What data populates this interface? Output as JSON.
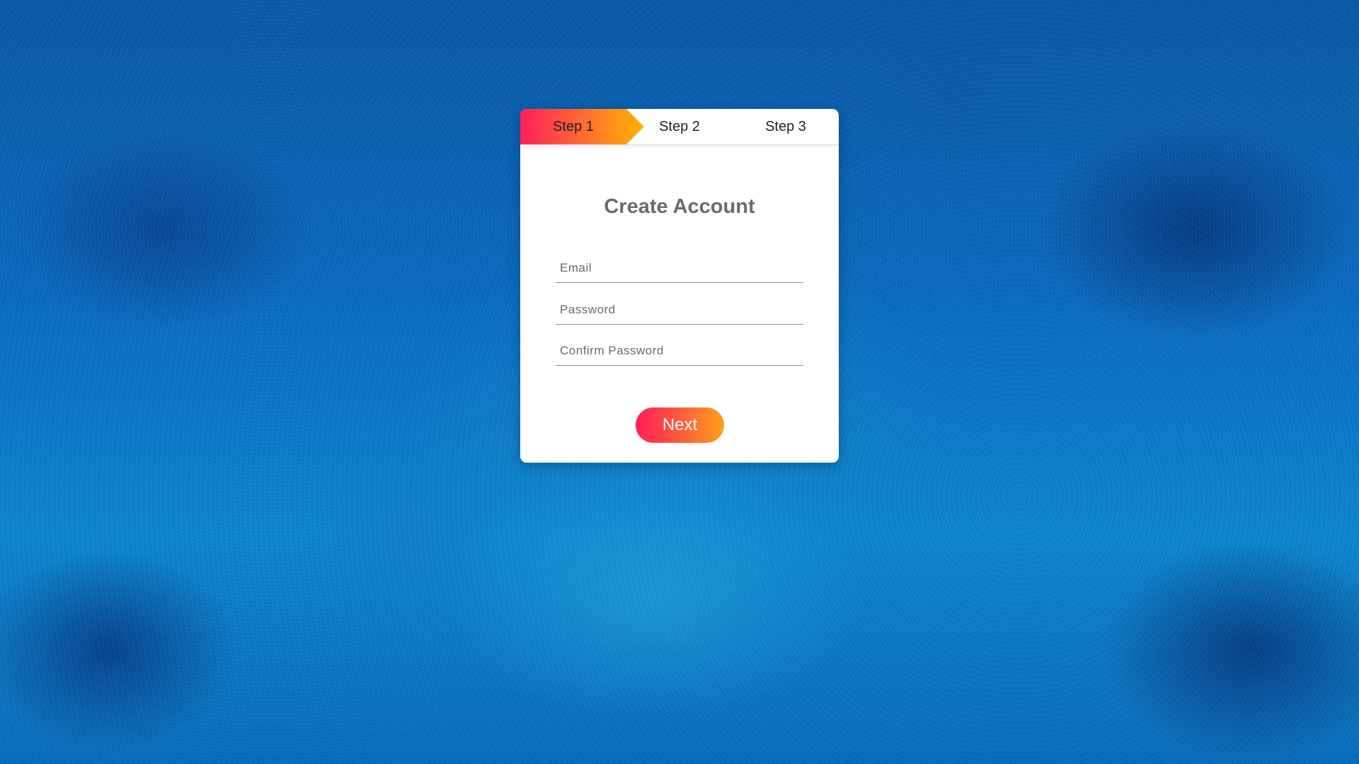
{
  "steps": [
    {
      "label": "Step 1",
      "active": true
    },
    {
      "label": "Step 2",
      "active": false
    },
    {
      "label": "Step 3",
      "active": false
    }
  ],
  "form": {
    "title": "Create Account",
    "email_placeholder": "Email",
    "password_placeholder": "Password",
    "confirm_password_placeholder": "Confirm Password",
    "next_label": "Next"
  },
  "colors": {
    "gradient_start": "#ff1f5a",
    "gradient_end": "#ffb300",
    "background_blue": "#0b6cc0",
    "card": "#ffffff",
    "title": "#6b6b6b"
  }
}
